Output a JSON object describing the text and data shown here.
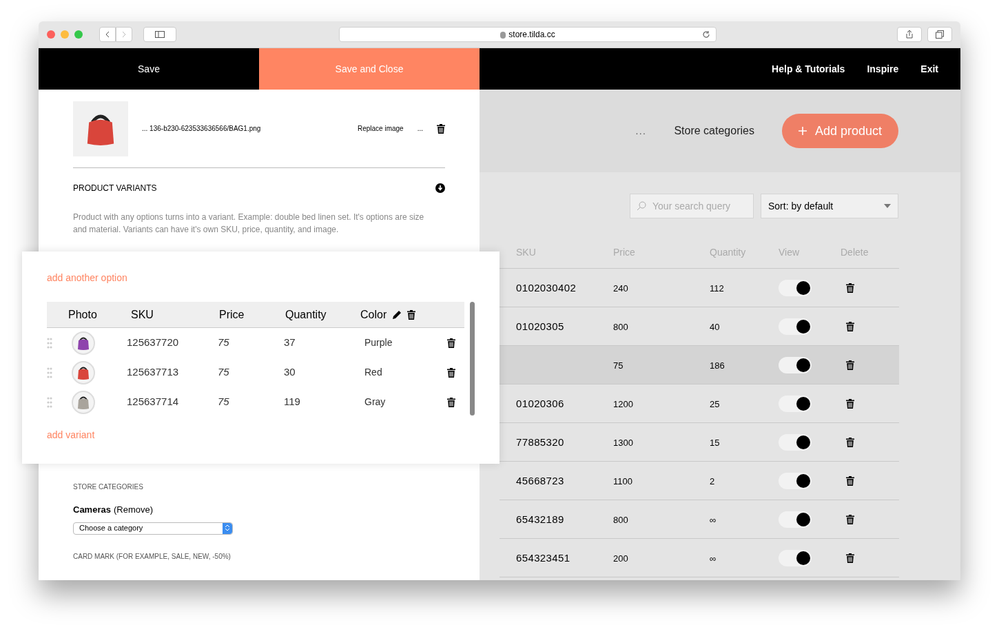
{
  "browser": {
    "url": "store.tilda.cc"
  },
  "header": {
    "buttons": [
      {
        "label": "Save",
        "kind": "plain"
      },
      {
        "label": "Save and Close",
        "kind": "accent"
      }
    ],
    "links": [
      "Help & Tutorials",
      "Inspire",
      "Exit"
    ]
  },
  "editor": {
    "image_file": "... 136-b230-623533636566/BAG1.png",
    "replace": "Replace image",
    "more": "...",
    "variants_title": "PRODUCT VARIANTS",
    "description": "Product with any options turns into a variant. Example: double bed linen set. It's options are size and material. Variants can have it's own SKU, price, quantity, and image.",
    "categories_title": "STORE CATEGORIES",
    "category": "Cameras",
    "remove": "(Remove)",
    "category_select": "Choose a category",
    "card_mark": "CARD MARK (FOR EXAMPLE, SALE, NEW, -50%)"
  },
  "variants": {
    "add_option": "add another option",
    "columns": [
      "Photo",
      "SKU",
      "Price",
      "Quantity",
      "Color"
    ],
    "rows": [
      {
        "sku": "125637720",
        "price": "75",
        "quantity": "37",
        "color_name": "Purple",
        "color": "#8e44ad"
      },
      {
        "sku": "125637713",
        "price": "75",
        "quantity": "30",
        "color_name": "Red",
        "color": "#d9453b"
      },
      {
        "sku": "125637714",
        "price": "75",
        "quantity": "119",
        "color_name": "Gray",
        "color": "#a9a49c"
      }
    ],
    "add_variant": "add variant"
  },
  "store": {
    "more": "...",
    "categories": "Store categories",
    "add_product": "Add product",
    "search": {
      "placeholder": "Your search query"
    },
    "sort": "Sort: by default",
    "columns": [
      "SKU",
      "Price",
      "Quantity",
      "View",
      "Delete"
    ],
    "rows": [
      {
        "sku": "0102030402",
        "price": "240",
        "quantity": "112",
        "visible": true,
        "selected": false
      },
      {
        "sku": "01020305",
        "price": "800",
        "quantity": "40",
        "visible": true,
        "selected": false
      },
      {
        "sku": "",
        "price": "75",
        "quantity": "186",
        "visible": true,
        "selected": true
      },
      {
        "sku": "01020306",
        "price": "1200",
        "quantity": "25",
        "visible": true,
        "selected": false
      },
      {
        "sku": "77885320",
        "price": "1300",
        "quantity": "15",
        "visible": true,
        "selected": false
      },
      {
        "sku": "45668723",
        "price": "1100",
        "quantity": "2",
        "visible": true,
        "selected": false
      },
      {
        "sku": "65432189",
        "price": "800",
        "quantity": "∞",
        "visible": true,
        "selected": false
      },
      {
        "sku": "654323451",
        "price": "200",
        "quantity": "∞",
        "visible": true,
        "selected": false
      }
    ]
  }
}
